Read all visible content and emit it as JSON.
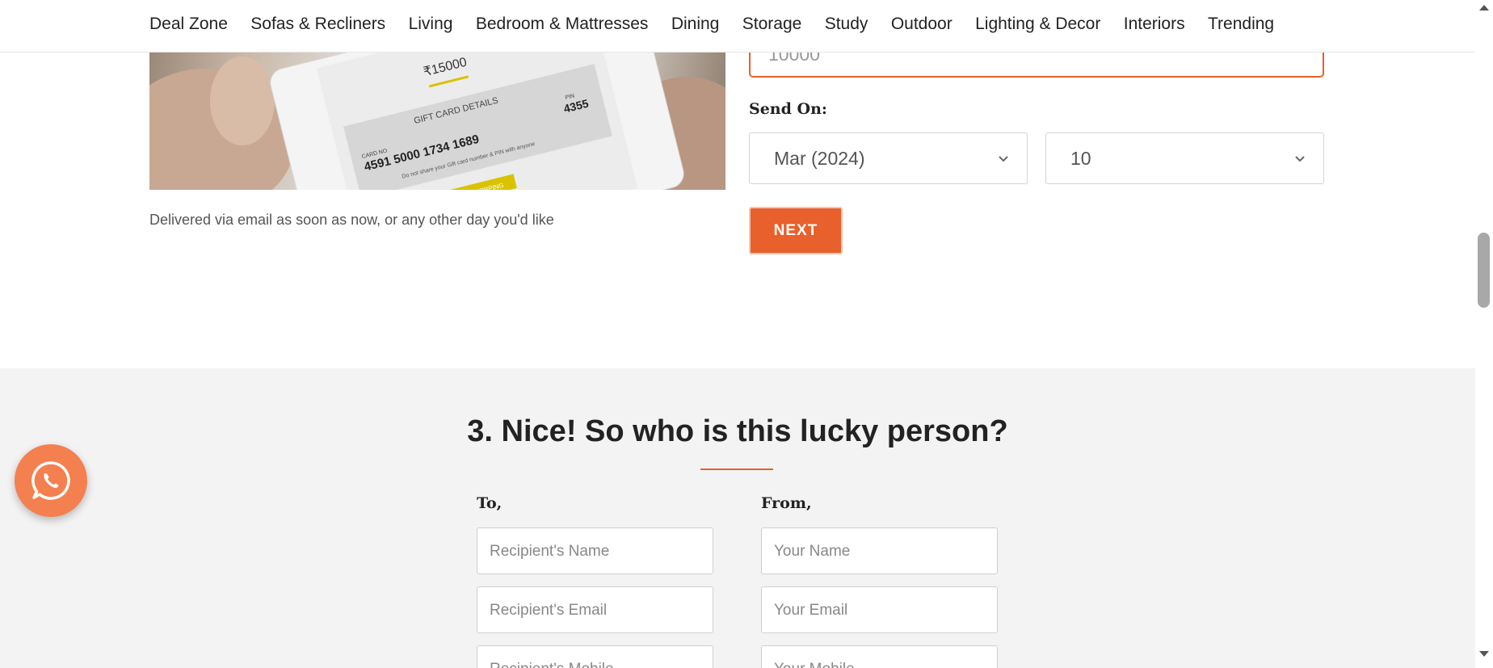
{
  "nav": {
    "items": [
      {
        "label": "Deal Zone"
      },
      {
        "label": "Sofas & Recliners"
      },
      {
        "label": "Living"
      },
      {
        "label": "Bedroom & Mattresses"
      },
      {
        "label": "Dining"
      },
      {
        "label": "Storage"
      },
      {
        "label": "Study"
      },
      {
        "label": "Outdoor"
      },
      {
        "label": "Lighting & Decor"
      },
      {
        "label": "Interiors"
      },
      {
        "label": "Trending"
      }
    ]
  },
  "gift_card_image": {
    "amount": "₹15000",
    "details_heading": "GIFT CARD DETAILS",
    "card_no_label": "CARD NO",
    "card_no": "4591 5000 1734 1689",
    "pin_label": "PIN",
    "pin": "4355",
    "notice": "Do not share your Gift card number & PIN with anyone",
    "cta": "START SHOPPING"
  },
  "delivered_text": "Delivered via email as soon as now, or any other day you'd like",
  "amount_field": {
    "value": "10000"
  },
  "send_on": {
    "label": "Send On:",
    "month_selected": "Mar (2024)",
    "day_selected": "10"
  },
  "next_button": "NEXT",
  "recipient_section": {
    "title": "3. Nice! So who is this lucky person?",
    "to_label": "To,",
    "from_label": "From,",
    "to_fields": [
      {
        "placeholder": "Recipient's Name"
      },
      {
        "placeholder": "Recipient's Email"
      },
      {
        "placeholder": "Recipient's Mobile"
      }
    ],
    "from_fields": [
      {
        "placeholder": "Your Name"
      },
      {
        "placeholder": "Your Email"
      },
      {
        "placeholder": "Your Mobile"
      }
    ]
  },
  "colors": {
    "accent": "#e8602c",
    "whatsapp_bg": "#f4804f",
    "section_grey": "#f3f3f3"
  },
  "icons": {
    "whatsapp": "whatsapp-icon",
    "chevron": "chevron-down-icon"
  }
}
